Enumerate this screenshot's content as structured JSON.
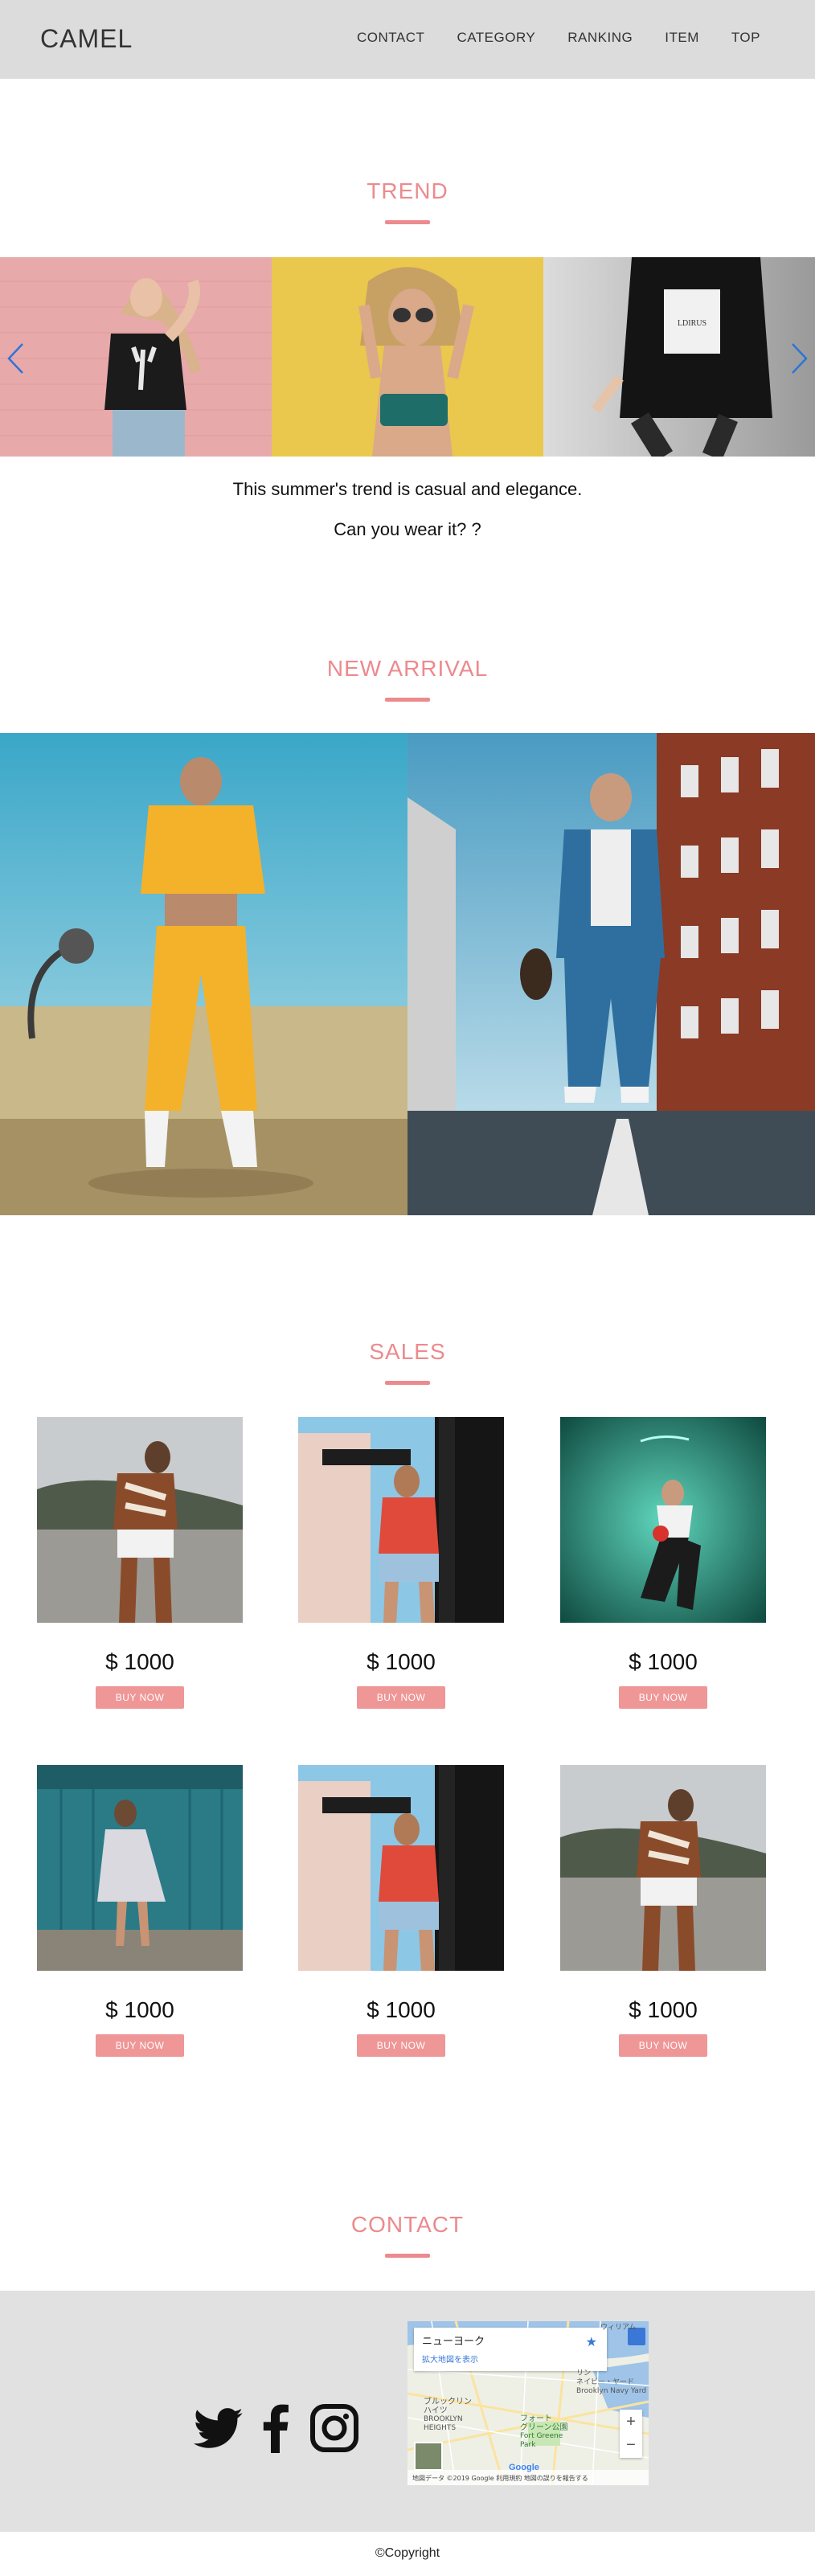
{
  "header": {
    "logo": "CAMEL",
    "nav": [
      "CONTACT",
      "CATEGORY",
      "RANKING",
      "ITEM",
      "TOP"
    ]
  },
  "trend": {
    "title": "TREND",
    "line1": "This summer's trend is casual and elegance.",
    "line2": "Can you wear it? ?",
    "slides": [
      {
        "bg": "#e8a9ab",
        "shirt": "#1b1b1b"
      },
      {
        "bg": "#e7c23f",
        "shirt": "#1f6d68"
      },
      {
        "bg": "#bfbfbf",
        "shirt": "#141414"
      }
    ]
  },
  "arrival": {
    "title": "NEW ARRIVAL"
  },
  "sales": {
    "title": "SALES",
    "items": [
      {
        "price": "$ 1000",
        "button": "BUY NOW",
        "bg": "#c9ccce",
        "accent": "#8a4b2b"
      },
      {
        "price": "$ 1000",
        "button": "BUY NOW",
        "bg": "#8cc7e6",
        "accent": "#e04a3a"
      },
      {
        "price": "$ 1000",
        "button": "BUY NOW",
        "bg": "#2a8e7d",
        "accent": "#1b1b1b"
      },
      {
        "price": "$ 1000",
        "button": "BUY NOW",
        "bg": "#2a7b86",
        "accent": "#d9d9df"
      },
      {
        "price": "$ 1000",
        "button": "BUY NOW",
        "bg": "#8cc7e6",
        "accent": "#e04a3a"
      },
      {
        "price": "$ 1000",
        "button": "BUY NOW",
        "bg": "#c9ccce",
        "accent": "#8a4b2b"
      }
    ]
  },
  "contact": {
    "title": "CONTACT",
    "social": [
      "twitter-icon",
      "facebook-icon",
      "instagram-icon"
    ],
    "map": {
      "place": "ニューヨーク",
      "link": "拡大地図を表示",
      "label_a": "ブルックリン",
      "label_b": "ハイツ",
      "label_c": "BROOKLYN",
      "label_d": "HEIGHTS",
      "label_e": "フォート",
      "label_f": "グリーン公園",
      "label_g": "Fort Greene",
      "label_h": "Park",
      "label_i": "Brooklyn Navy Yard",
      "label_j": "ネイビー・ヤード",
      "label_k": "ウィリアム",
      "label_l": "リン",
      "footer": "地図データ ©2019 Google   利用規約   地図の誤りを報告する",
      "brand": "Google"
    }
  },
  "footer": {
    "copyright": "©Copyright"
  },
  "colors": {
    "accent": "#ec8a8e",
    "header_bg": "#dcdcdc",
    "footer_bg": "#e1e1e1",
    "arrow": "#2d74d8"
  }
}
